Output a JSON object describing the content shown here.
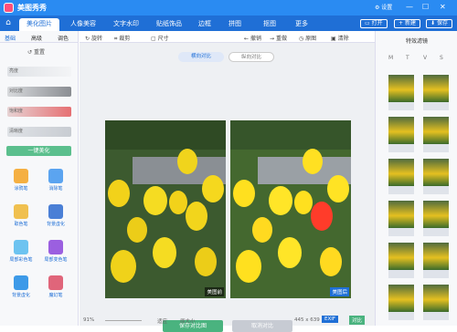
{
  "titlebar": {
    "app_name": "美图秀秀",
    "settings": "设置",
    "open": "打开",
    "new": "新建",
    "save": "保存"
  },
  "nav": {
    "tabs": [
      "美化图片",
      "人像美容",
      "文字水印",
      "贴纸饰品",
      "边框",
      "拼图",
      "抠图",
      "更多"
    ],
    "active": 0
  },
  "left": {
    "tabs": [
      "基础",
      "高级",
      "调色"
    ],
    "reset": "重置",
    "sliders": [
      "亮度",
      "对比度",
      "饱和度",
      "清晰度"
    ],
    "onekey": "一键美化",
    "tools": [
      "涂鸦笔",
      "消除笔",
      "取色笔",
      "背景虚化",
      "局部彩色笔",
      "局部变色笔",
      "背景虚化",
      "魔幻笔"
    ]
  },
  "toolbar": {
    "items": [
      "旋转",
      "裁剪",
      "尺寸",
      "撤销",
      "重做",
      "原图",
      "清除"
    ]
  },
  "compare": {
    "left": "横向对比",
    "right": "纵向对比"
  },
  "photos": {
    "before": "美图前",
    "after": "美图后"
  },
  "actions": {
    "save": "保存对比图",
    "cancel": "取消对比"
  },
  "status": {
    "zoom": "91%",
    "fit": "适应",
    "real": "原大小",
    "dims": "445 x 639",
    "exif": "EXIF",
    "compare": "对比"
  },
  "right": {
    "title": "特效滤镜",
    "tabs": [
      "M",
      "T",
      "V",
      "S"
    ],
    "filters": [
      "",
      "",
      "",
      "",
      "",
      "",
      "",
      "",
      "",
      "",
      "",
      ""
    ]
  },
  "colors": {
    "title_bar": "#2a8bf2",
    "nav_bar": "#1f6fd6",
    "save_green": "#4ab37f"
  }
}
